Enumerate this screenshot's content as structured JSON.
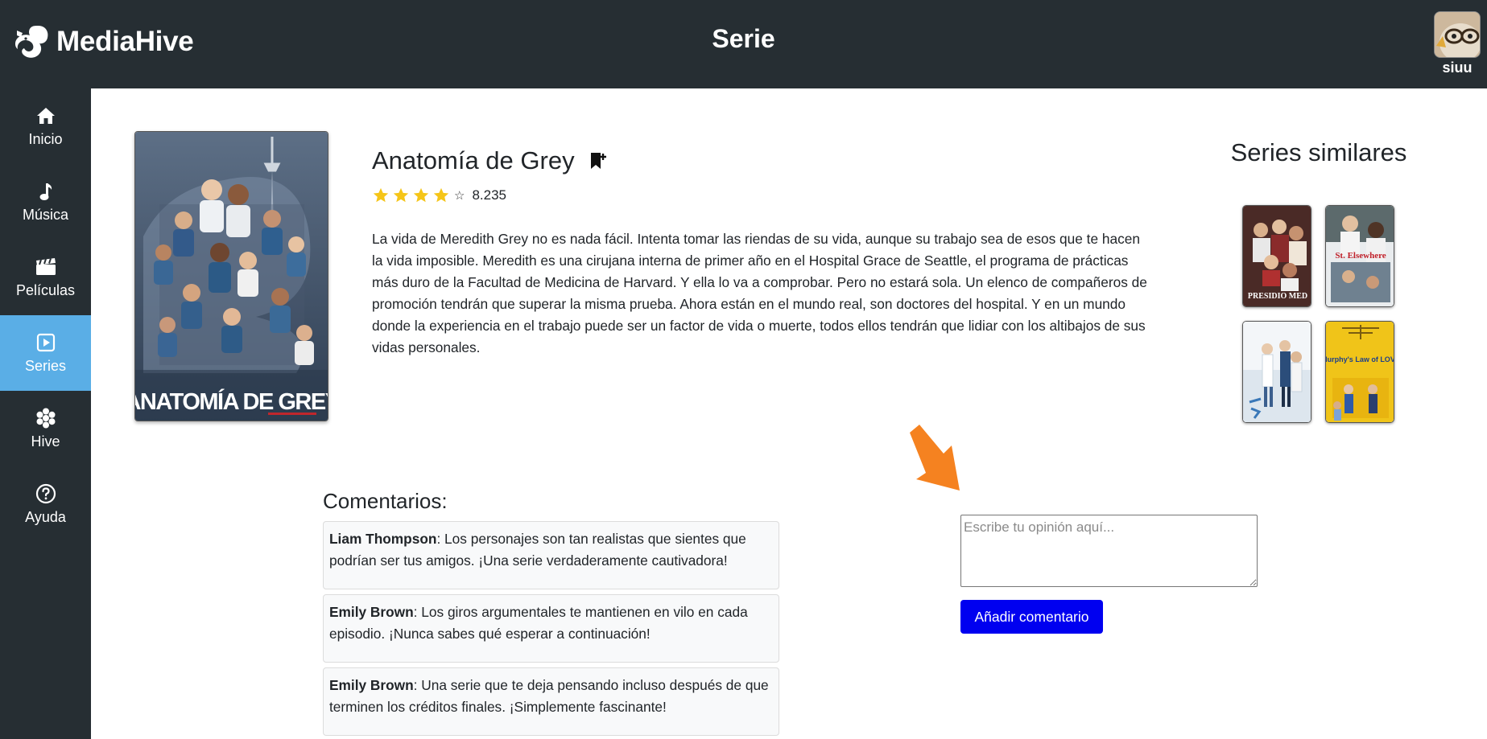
{
  "app": {
    "name": "MediaHive",
    "logo_icon": "squirrel-logo-icon"
  },
  "header": {
    "page_title": "Serie"
  },
  "user": {
    "name": "siuu",
    "avatar_icon": "user-avatar"
  },
  "sidebar": {
    "items": [
      {
        "label": "Inicio",
        "icon": "home-icon",
        "active": false
      },
      {
        "label": "Música",
        "icon": "music-note-icon",
        "active": false
      },
      {
        "label": "Películas",
        "icon": "film-icon",
        "active": false
      },
      {
        "label": "Series",
        "icon": "play-square-icon",
        "active": true
      },
      {
        "label": "Hive",
        "icon": "hive-flower-icon",
        "active": false
      },
      {
        "label": "Ayuda",
        "icon": "help-circle-icon",
        "active": false
      }
    ]
  },
  "series": {
    "title": "Anatomía de Grey",
    "poster_text": "ANATOMÍA DE GREY",
    "rating": {
      "value": "8.235",
      "filled_stars": 4,
      "total_stars": 5
    },
    "synopsis": "La vida de Meredith Grey no es nada fácil. Intenta tomar las riendas de su vida, aunque su trabajo sea de esos que te hacen la vida imposible. Meredith es una cirujana interna de primer año en el Hospital Grace de Seattle, el programa de prácticas más duro de la Facultad de Medicina de Harvard. Y ella lo va a comprobar. Pero no estará sola. Un elenco de compañeros de promoción tendrán que superar la misma prueba. Ahora están en el mundo real, son doctores del hospital. Y en un mundo donde la experiencia en el trabajo puede ser un factor de vida o muerte, todos ellos tendrán que lidiar con los altibajos de sus vidas personales."
  },
  "similar": {
    "heading": "Series similares",
    "items": [
      {
        "poster_text": "PRESIDIO MED"
      },
      {
        "poster_text": "St. Elsewhere"
      },
      {
        "poster_text": ""
      },
      {
        "poster_text": "Murphy's Law of LOVE"
      }
    ]
  },
  "comments": {
    "heading": "Comentarios:",
    "items": [
      {
        "author": "Liam Thompson",
        "text": ": Los personajes son tan realistas que sientes que podrían ser tus amigos. ¡Una serie verdaderamente cautivadora!"
      },
      {
        "author": "Emily Brown",
        "text": ": Los giros argumentales te mantienen en vilo en cada episodio. ¡Nunca sabes qué esperar a continuación!"
      },
      {
        "author": "Emily Brown",
        "text": ": Una serie que te deja pensando incluso después de que terminen los créditos finales. ¡Simplemente fascinante!"
      }
    ],
    "input_placeholder": "Escribe tu opinión aquí...",
    "input_value": "",
    "add_button_label": "Añadir comentario"
  },
  "colors": {
    "topbar": "#262e33",
    "active_nav": "#5aaee6",
    "primary_button": "#0000f0",
    "star": "#f5c518",
    "arrow": "#f58220"
  }
}
